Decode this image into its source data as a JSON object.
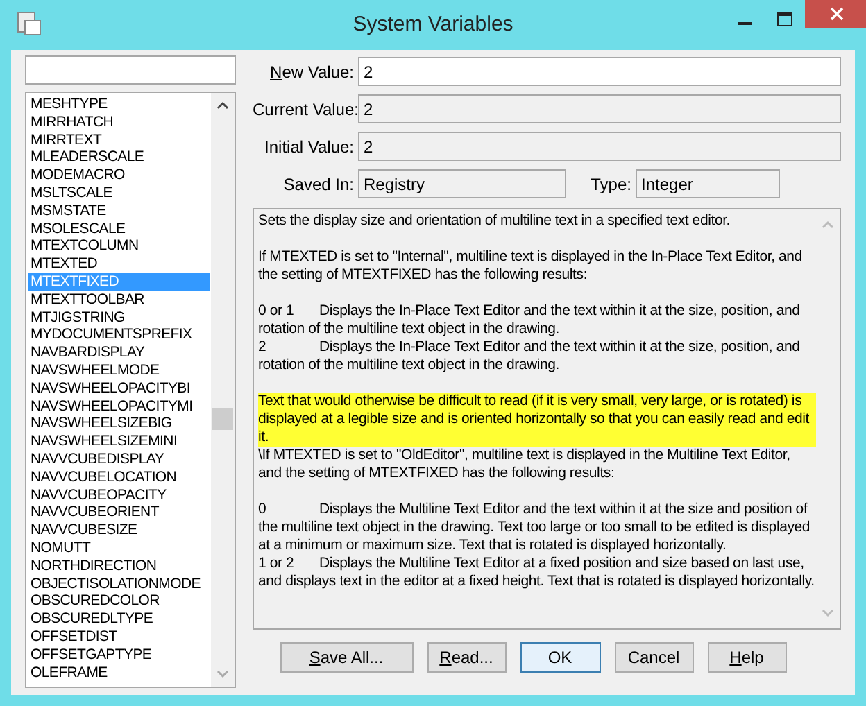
{
  "window": {
    "title": "System Variables"
  },
  "variables": [
    {
      "name": "MESHTYPE",
      "selected": false
    },
    {
      "name": "MIRRHATCH",
      "selected": false
    },
    {
      "name": "MIRRTEXT",
      "selected": false
    },
    {
      "name": "MLEADERSCALE",
      "selected": false
    },
    {
      "name": "MODEMACRO",
      "selected": false
    },
    {
      "name": "MSLTSCALE",
      "selected": false
    },
    {
      "name": "MSMSTATE",
      "selected": false
    },
    {
      "name": "MSOLESCALE",
      "selected": false
    },
    {
      "name": "MTEXTCOLUMN",
      "selected": false
    },
    {
      "name": "MTEXTED",
      "selected": false
    },
    {
      "name": "MTEXTFIXED",
      "selected": true
    },
    {
      "name": "MTEXTTOOLBAR",
      "selected": false
    },
    {
      "name": "MTJIGSTRING",
      "selected": false
    },
    {
      "name": "MYDOCUMENTSPREFIX",
      "selected": false
    },
    {
      "name": "NAVBARDISPLAY",
      "selected": false
    },
    {
      "name": "NAVSWHEELMODE",
      "selected": false
    },
    {
      "name": "NAVSWHEELOPACITYBI",
      "selected": false
    },
    {
      "name": "NAVSWHEELOPACITYMI",
      "selected": false
    },
    {
      "name": "NAVSWHEELSIZEBIG",
      "selected": false
    },
    {
      "name": "NAVSWHEELSIZEMINI",
      "selected": false
    },
    {
      "name": "NAVVCUBEDISPLAY",
      "selected": false
    },
    {
      "name": "NAVVCUBELOCATION",
      "selected": false
    },
    {
      "name": "NAVVCUBEOPACITY",
      "selected": false
    },
    {
      "name": "NAVVCUBEORIENT",
      "selected": false
    },
    {
      "name": "NAVVCUBESIZE",
      "selected": false
    },
    {
      "name": "NOMUTT",
      "selected": false
    },
    {
      "name": "NORTHDIRECTION",
      "selected": false
    },
    {
      "name": "OBJECTISOLATIONMODE",
      "selected": false
    },
    {
      "name": "OBSCUREDCOLOR",
      "selected": false
    },
    {
      "name": "OBSCUREDLTYPE",
      "selected": false
    },
    {
      "name": "OFFSETDIST",
      "selected": false
    },
    {
      "name": "OFFSETGAPTYPE",
      "selected": false
    },
    {
      "name": "OLEFRAME",
      "selected": false
    }
  ],
  "new_value": {
    "label": {
      "accel": "N",
      "rest": "ew Value:"
    },
    "value": "2"
  },
  "current_value": {
    "label": "Current Value:",
    "value": "2"
  },
  "initial_value": {
    "label": "Initial Value:",
    "value": "2"
  },
  "saved_in": {
    "label": "Saved In:",
    "value": "Registry"
  },
  "type": {
    "label": "Type:",
    "value": "Integer"
  },
  "description": [
    [
      {
        "kind": "para",
        "highlighted": false,
        "text": "Sets the display size and orientation of multiline text in a specified text editor."
      }
    ],
    [
      {
        "kind": "para",
        "highlighted": false,
        "text": "If MTEXTED is set to \"Internal\", multiline text is displayed in the In-Place Text Editor, and the setting of MTEXTFIXED has the following results:"
      }
    ],
    [
      {
        "kind": "option",
        "highlighted": false,
        "key": "0 or 1",
        "text": "Displays the In-Place Text Editor and the text within it at the size, position, and rotation of the multiline text object in the drawing."
      },
      {
        "kind": "option",
        "highlighted": false,
        "key": "2",
        "text": "Displays the In-Place Text Editor and the text within it at the size, position, and rotation of the multiline text object in the drawing."
      }
    ],
    [
      {
        "kind": "para",
        "highlighted": true,
        "text": "Text that would otherwise be difficult to read (if it is very small, very large, or is rotated) is displayed at a legible size and is oriented horizontally so that you can easily read and edit it."
      },
      {
        "kind": "para",
        "highlighted": false,
        "text": "\\If MTEXTED is set to \"OldEditor\", multiline text is displayed in the Multiline Text Editor, and the setting of MTEXTFIXED has the following results:"
      }
    ],
    [
      {
        "kind": "option",
        "highlighted": false,
        "key": "0",
        "text": "Displays the Multiline Text Editor and the text within it at the size and position of the multiline text object in the drawing. Text too large or too small to be edited is displayed at a minimum or maximum size. Text that is rotated is displayed horizontally."
      },
      {
        "kind": "option",
        "highlighted": false,
        "key": "1 or 2",
        "text": "Displays the Multiline Text Editor at a fixed position and size based on last use, and displays text in the editor at a fixed height. Text that is rotated is displayed horizontally."
      }
    ]
  ],
  "buttons": [
    {
      "accel": "S",
      "rest": "ave All...",
      "default": false
    },
    {
      "accel": "R",
      "rest": "ead...",
      "default": false
    },
    {
      "rest": "OK",
      "default": true
    },
    {
      "rest": "Cancel",
      "default": false
    },
    {
      "accel": "H",
      "rest": "elp",
      "default": false
    }
  ]
}
